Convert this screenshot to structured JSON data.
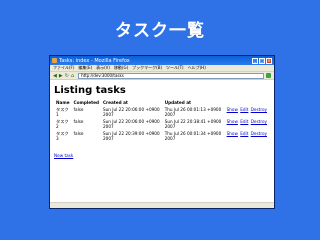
{
  "slide": {
    "title": "タスク一覧"
  },
  "browser": {
    "window_title": "Tasks: index - Mozilla Firefox",
    "menu": [
      "ファイル(F)",
      "編集(E)",
      "表示(V)",
      "移動(G)",
      "ブックマーク(B)",
      "ツール(T)",
      "ヘルプ(H)"
    ],
    "url": "http://dev:3000/tasks"
  },
  "page": {
    "heading": "Listing tasks",
    "columns": [
      "Name",
      "Completed",
      "Created at",
      "Updated at"
    ],
    "rows": [
      {
        "name": "タスク1",
        "completed": "false",
        "created": "Sun Jul 22 20:06:00 +0900 2007",
        "updated": "Thu Jul 26 00:01:13 +0900 2007"
      },
      {
        "name": "タスク2",
        "completed": "false",
        "created": "Sun Jul 22 20:06:00 +0900 2007",
        "updated": "Sun Jul 22 20:38:41 +0900 2007"
      },
      {
        "name": "タスク3",
        "completed": "false",
        "created": "Sun Jul 22 20:39:00 +0900 2007",
        "updated": "Thu Jul 26 00:01:34 +0900 2007"
      }
    ],
    "actions": {
      "show": "Show",
      "edit": "Edit",
      "destroy": "Destroy"
    },
    "new_link": "New task"
  }
}
